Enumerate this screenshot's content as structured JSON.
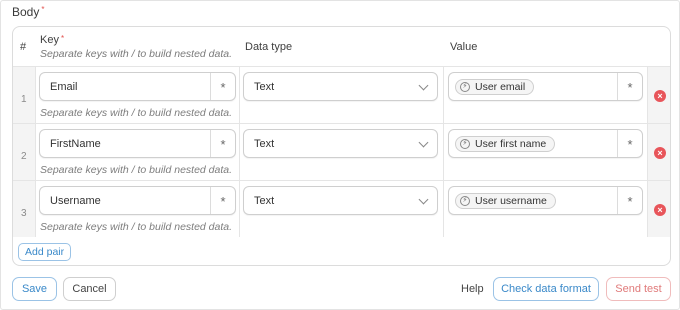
{
  "section": {
    "label": "Body",
    "required_mark": "*"
  },
  "columns": {
    "number": "#",
    "key": "Key",
    "key_required_mark": "*",
    "key_hint": "Separate keys with / to build nested data.",
    "data_type": "Data type",
    "value": "Value"
  },
  "rows": [
    {
      "index": "1",
      "key": "Email",
      "key_hint": "Separate keys with / to build nested data.",
      "data_type": "Text",
      "value": "User email"
    },
    {
      "index": "2",
      "key": "FirstName",
      "key_hint": "Separate keys with / to build nested data.",
      "data_type": "Text",
      "value": "User first name"
    },
    {
      "index": "3",
      "key": "Username",
      "key_hint": "Separate keys with / to build nested data.",
      "data_type": "Text",
      "value": "User username"
    }
  ],
  "star_glyph": "*",
  "add_pair_label": "Add pair",
  "footer": {
    "save_label": "Save",
    "cancel_label": "Cancel",
    "help_label": "Help",
    "check_label": "Check data format",
    "send_label": "Send test"
  },
  "colors": {
    "accent": "#3a89c9",
    "danger": "#e8555a",
    "required": "#e2504c"
  },
  "icons": {
    "value_chip": "dynamic-field-icon",
    "delete": "remove-circle-icon",
    "select": "chevron-down-icon",
    "field_action": "asterisk-icon"
  }
}
